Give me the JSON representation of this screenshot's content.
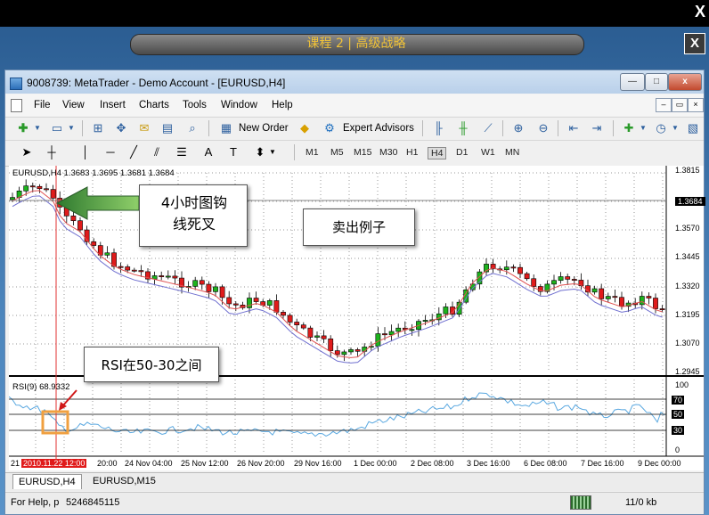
{
  "player": {
    "close_label": "X",
    "course_title": "课程 2 | 高级战略",
    "course_close_label": "X"
  },
  "window": {
    "title": "9008739: MetaTrader - Demo Account - [EURUSD,H4]",
    "minimize": "—",
    "maximize": "□",
    "close": "x"
  },
  "menu": {
    "items": [
      "File",
      "View",
      "Insert",
      "Charts",
      "Tools",
      "Window",
      "Help"
    ],
    "mdi_min": "–",
    "mdi_restore": "▭",
    "mdi_close": "×"
  },
  "toolbar": {
    "new_order_label": "New Order",
    "expert_advisors_label": "Expert Advisors"
  },
  "timeframes": [
    "M1",
    "M5",
    "M15",
    "M30",
    "H1",
    "H4",
    "D1",
    "W1",
    "MN"
  ],
  "active_timeframe": "H4",
  "chart": {
    "symbol_info": "EURUSD,H4  1.3683 1.3695 1.3681 1.3684",
    "current_price": "1.3684",
    "price_axis": [
      "1.3815",
      "1.3570",
      "1.3445",
      "1.3320",
      "1.3195",
      "1.3070",
      "1.2945"
    ],
    "rsi_label": "RSI(9) 68.9332",
    "rsi_axis": [
      "100",
      "70",
      "50",
      "30",
      "0"
    ],
    "time_axis": [
      "21",
      "20:00",
      "24 Nov 04:00",
      "25 Nov 12:00",
      "26 Nov 20:00",
      "29 Nov 16:00",
      "1 Dec 00:00",
      "2 Dec 08:00",
      "3 Dec 16:00",
      "6 Dec 08:00",
      "7 Dec 16:00",
      "9 Dec 00:00"
    ],
    "highlight_time": "2010.11.22 12:00",
    "colors": {
      "bull": "#1db31d",
      "bear": "#e01b1b",
      "ma_fast": "#e05050",
      "ma_slow": "#7070d0",
      "rsi": "#5aa8e0"
    }
  },
  "annotations": {
    "callout_1": "4小时图钩线死叉",
    "callout_2": "卖出例子",
    "callout_3": "RSI在50-30之间"
  },
  "tabs": [
    "EURUSD,H4",
    "EURUSD,M15"
  ],
  "status": {
    "help_text": "For Help, p",
    "code": "5246845115",
    "traffic": "11/0 kb"
  }
}
